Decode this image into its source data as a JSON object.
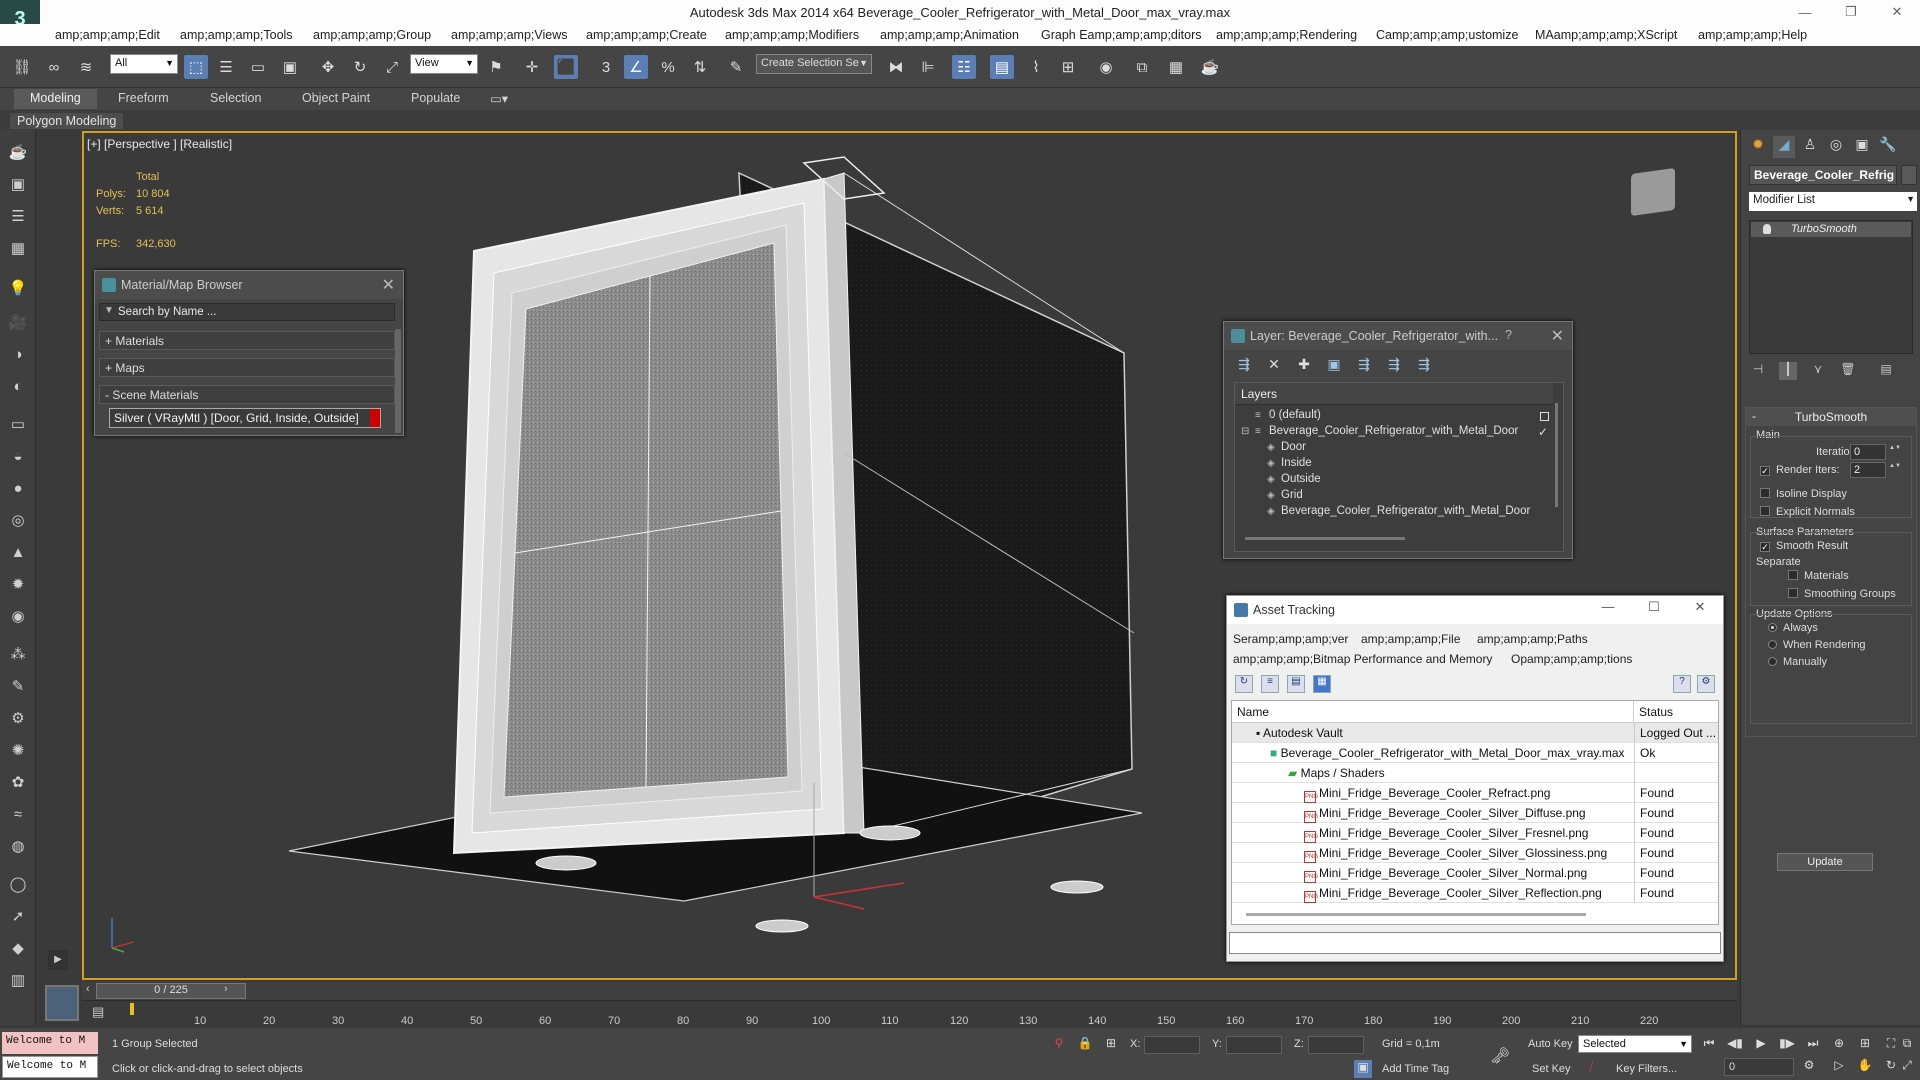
{
  "app": {
    "title": "Autodesk 3ds Max  2014 x64     Beverage_Cooler_Refrigerator_with_Metal_Door_max_vray.max",
    "window_buttons": [
      "—",
      "❐",
      "✕"
    ]
  },
  "menu": [
    "amp;amp;amp;Edit",
    "amp;amp;amp;Tools",
    "amp;amp;amp;Group",
    "amp;amp;amp;Views",
    "amp;amp;amp;Create",
    "amp;amp;amp;Modifiers",
    "amp;amp;amp;Animation",
    "Graph Eamp;amp;amp;ditors",
    "amp;amp;amp;Rendering",
    "Camp;amp;amp;ustomize",
    "MAamp;amp;amp;XScript",
    "amp;amp;amp;Help"
  ],
  "toolbar": {
    "selection_filter": "All",
    "ref_coord": "View",
    "named_selection": "Create Selection Se"
  },
  "ribbon": {
    "tabs": [
      "Modeling",
      "Freeform",
      "Selection",
      "Object Paint",
      "Populate"
    ],
    "active_panel": "Polygon Modeling"
  },
  "viewport": {
    "label": "[+] [Perspective ] [Realistic]",
    "stats": {
      "total_label": "Total",
      "polys_label": "Polys:",
      "polys_value": "10 804",
      "verts_label": "Verts:",
      "verts_value": "5 614",
      "fps_label": "FPS:",
      "fps_value": "342,630"
    }
  },
  "material_browser": {
    "title": "Material/Map Browser",
    "search_placeholder": "Search by Name ...",
    "rows": [
      "+ Materials",
      "+ Maps",
      "- Scene Materials"
    ],
    "material": "Silver  ( VRayMtl )  [Door, Grid, Inside, Outside]"
  },
  "layer_panel": {
    "title": "Layer: Beverage_Cooler_Refrigerator_with...",
    "help": "?",
    "header": "Layers",
    "layers": [
      {
        "name": "0 (default)"
      },
      {
        "name": "Beverage_Cooler_Refrigerator_with_Metal_Door"
      },
      {
        "name": "Door"
      },
      {
        "name": "Inside"
      },
      {
        "name": "Outside"
      },
      {
        "name": "Grid"
      },
      {
        "name": "Beverage_Cooler_Refrigerator_with_Metal_Door"
      }
    ]
  },
  "asset_tracking": {
    "title": "Asset Tracking",
    "menu": [
      "Seramp;amp;amp;ver",
      "amp;amp;amp;File",
      "amp;amp;amp;Paths",
      "amp;amp;amp;Bitmap Performance and Memory",
      "Opamp;amp;amp;tions"
    ],
    "col_name": "Name",
    "col_status": "Status",
    "rows": [
      {
        "name": "Autodesk Vault",
        "status": "Logged Out ..."
      },
      {
        "name": "Beverage_Cooler_Refrigerator_with_Metal_Door_max_vray.max",
        "status": "Ok"
      },
      {
        "name": "Maps / Shaders",
        "status": ""
      },
      {
        "name": "Mini_Fridge_Beverage_Cooler_Refract.png",
        "status": "Found"
      },
      {
        "name": "Mini_Fridge_Beverage_Cooler_Silver_Diffuse.png",
        "status": "Found"
      },
      {
        "name": "Mini_Fridge_Beverage_Cooler_Silver_Fresnel.png",
        "status": "Found"
      },
      {
        "name": "Mini_Fridge_Beverage_Cooler_Silver_Glossiness.png",
        "status": "Found"
      },
      {
        "name": "Mini_Fridge_Beverage_Cooler_Silver_Normal.png",
        "status": "Found"
      },
      {
        "name": "Mini_Fridge_Beverage_Cooler_Silver_Reflection.png",
        "status": "Found"
      }
    ],
    "png_icon": "PNG"
  },
  "command_panel": {
    "object_name": "Beverage_Cooler_Refrig",
    "modifier_list": "Modifier List",
    "stack_item": "TurboSmooth",
    "rollout": "TurboSmooth",
    "main_label": "Main",
    "iterations_label": "Iterations:",
    "iterations_value": "0",
    "render_iters_label": "Render Iters:",
    "render_iters_value": "2",
    "isoline": "Isoline Display",
    "explicit": "Explicit Normals",
    "surface_params": "Surface Parameters",
    "smooth_result": "Smooth Result",
    "separate": "Separate",
    "materials": "Materials",
    "smoothing_groups": "Smoothing Groups",
    "update_options": "Update Options",
    "always": "Always",
    "when_rendering": "When Rendering",
    "manually": "Manually",
    "update_btn": "Update"
  },
  "timeline": {
    "frame": "0 / 225",
    "ticks": [
      "10",
      "20",
      "30",
      "40",
      "50",
      "60",
      "70",
      "80",
      "90",
      "100",
      "110",
      "120",
      "130",
      "140",
      "150",
      "160",
      "170",
      "180",
      "190",
      "200",
      "210",
      "220"
    ]
  },
  "status": {
    "welcome": "Welcome to M",
    "selection": "1 Group Selected",
    "prompt": "Click or click-and-drag to select objects",
    "x_label": "X:",
    "y_label": "Y:",
    "z_label": "Z:",
    "grid": "Grid = 0,1m",
    "add_time_tag": "Add Time Tag",
    "auto_key": "Auto Key",
    "set_key": "Set Key",
    "selected": "Selected",
    "key_filters": "Key Filters...",
    "frame_value": "0"
  },
  "colors": {
    "viewport_border": "#d0a01e",
    "stats_text": "#e0c050",
    "accent": "#5b7fb5"
  }
}
